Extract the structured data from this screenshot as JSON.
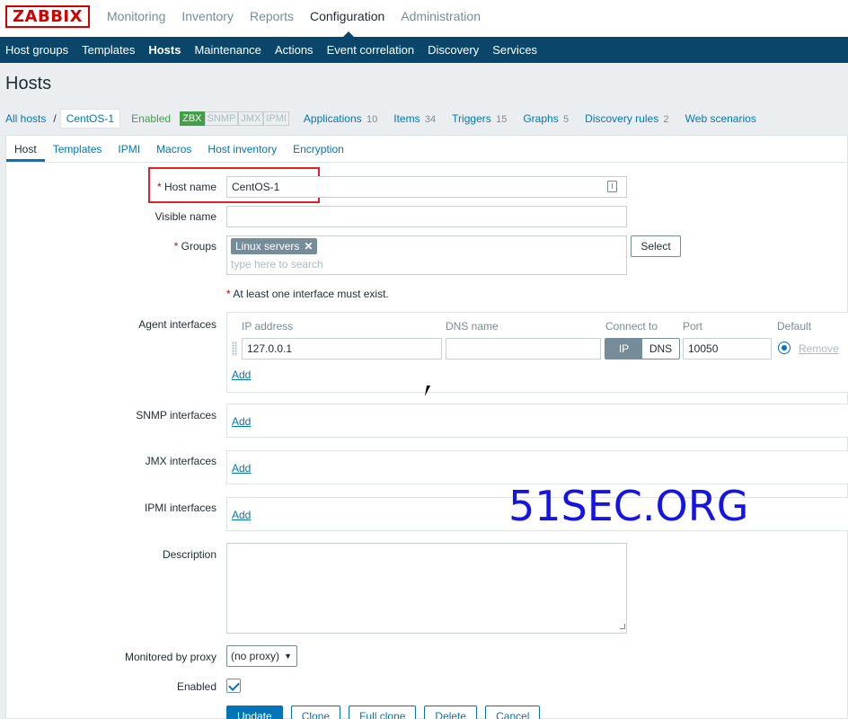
{
  "logo": "ZABBIX",
  "main_nav": [
    "Monitoring",
    "Inventory",
    "Reports",
    "Configuration",
    "Administration"
  ],
  "sub_nav": [
    "Host groups",
    "Templates",
    "Hosts",
    "Maintenance",
    "Actions",
    "Event correlation",
    "Discovery",
    "Services"
  ],
  "page_title": "Hosts",
  "breadcrumb": {
    "all_hosts": "All hosts",
    "separator": "/",
    "current": "CentOS-1",
    "status": "Enabled",
    "availability": [
      "ZBX",
      "SNMP",
      "JMX",
      "IPMI"
    ],
    "links": [
      {
        "label": "Applications",
        "count": "10"
      },
      {
        "label": "Items",
        "count": "34"
      },
      {
        "label": "Triggers",
        "count": "15"
      },
      {
        "label": "Graphs",
        "count": "5"
      },
      {
        "label": "Discovery rules",
        "count": "2"
      },
      {
        "label": "Web scenarios",
        "count": ""
      }
    ]
  },
  "tabs": [
    "Host",
    "Templates",
    "IPMI",
    "Macros",
    "Host inventory",
    "Encryption"
  ],
  "form": {
    "host_name_label": "Host name",
    "host_name_value": "CentOS-1",
    "visible_name_label": "Visible name",
    "visible_name_value": "",
    "groups_label": "Groups",
    "groups_chip": "Linux servers",
    "groups_placeholder": "type here to search",
    "select_button": "Select",
    "interface_note": "At least one interface must exist.",
    "agent_interfaces_label": "Agent interfaces",
    "columns": [
      "IP address",
      "DNS name",
      "Connect to",
      "Port",
      "Default"
    ],
    "ip_value": "127.0.0.1",
    "dns_value": "",
    "connect_options": [
      "IP",
      "DNS"
    ],
    "port_value": "10050",
    "remove_label": "Remove",
    "add_label": "Add",
    "snmp_label": "SNMP interfaces",
    "jmx_label": "JMX interfaces",
    "ipmi_label": "IPMI interfaces",
    "description_label": "Description",
    "proxy_label": "Monitored by proxy",
    "proxy_value": "(no proxy)",
    "enabled_label": "Enabled",
    "enabled_checked": true,
    "buttons": [
      "Update",
      "Clone",
      "Full clone",
      "Delete",
      "Cancel"
    ]
  },
  "watermark": "51SEC.ORG",
  "colors": {
    "nav_bg": "#0a466a",
    "link": "#0275b8",
    "logo": "#d40000",
    "enabled": "#429e47",
    "watermark": "#1414e6"
  }
}
